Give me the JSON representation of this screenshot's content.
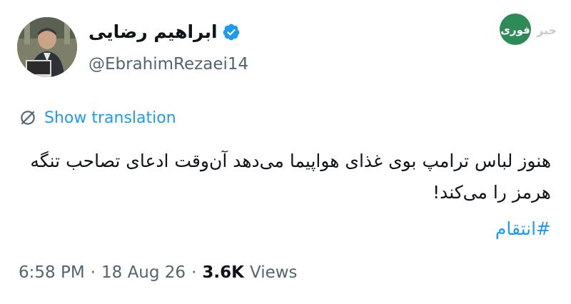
{
  "author": {
    "display_name": "ابراهیم رضایی",
    "handle": "@EbrahimRezaei14",
    "verified_icon": "verified-badge-icon",
    "verified_color": "#1d9bf0"
  },
  "watermark": {
    "text": "خبر فوری",
    "color": "#2e8b57"
  },
  "translation": {
    "icon": "translate-off-icon",
    "label": "Show translation"
  },
  "tweet": {
    "text": "هنوز لباس ترامپ بوی غذای هواپیما می‌دهد آن‌وقت ادعای تصاحب تنگه هرمز را می‌کند!",
    "hashtag": "#انتقام"
  },
  "meta": {
    "time": "6:58 PM",
    "separator": "·",
    "date": "18 Aug 26",
    "views_count": "3.6K",
    "views_label": "Views"
  }
}
